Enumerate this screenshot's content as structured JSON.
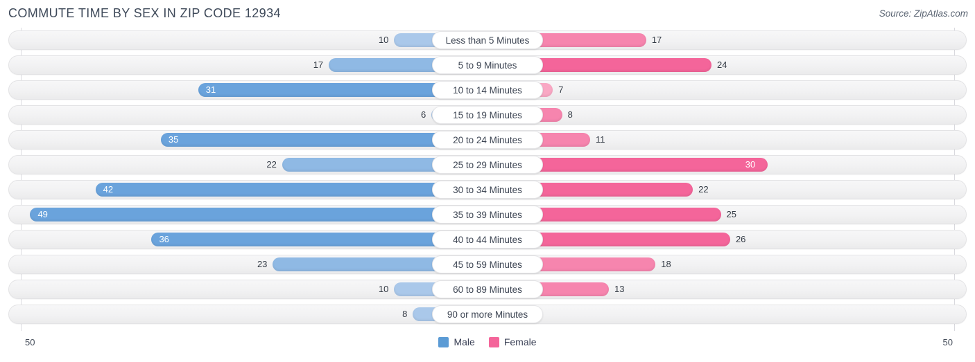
{
  "header": {
    "title": "COMMUTE TIME BY SEX IN ZIP CODE 12934",
    "source": "Source: ZipAtlas.com"
  },
  "axis": {
    "left_max_label": "50",
    "right_max_label": "50"
  },
  "legend": {
    "items": [
      {
        "label": "Male",
        "color": "#5b9bd5"
      },
      {
        "label": "Female",
        "color": "#f4659a"
      }
    ]
  },
  "colors": {
    "male": "#6aa3dc",
    "male_light": "#aac8ea",
    "female": "#f4659a",
    "female_light": "#f9a8c4",
    "track": "#f2f2f3",
    "gridline": "#d9d9de",
    "text": "#3c4257"
  },
  "chart_data": {
    "type": "bar",
    "subtype": "diverging-tornado",
    "title": "COMMUTE TIME BY SEX IN ZIP CODE 12934",
    "subtitle": "",
    "xlabel": "",
    "ylabel": "",
    "xlim": [
      0,
      50
    ],
    "grid": true,
    "legend_position": "bottom-center",
    "axis_max": 50,
    "categories": [
      "Less than 5 Minutes",
      "5 to 9 Minutes",
      "10 to 14 Minutes",
      "15 to 19 Minutes",
      "20 to 24 Minutes",
      "25 to 29 Minutes",
      "30 to 34 Minutes",
      "35 to 39 Minutes",
      "40 to 44 Minutes",
      "45 to 59 Minutes",
      "60 to 89 Minutes",
      "90 or more Minutes"
    ],
    "series": [
      {
        "name": "Male",
        "side": "left",
        "color": "#6aa3dc",
        "values": [
          10,
          17,
          31,
          6,
          35,
          22,
          42,
          49,
          36,
          23,
          10,
          8
        ]
      },
      {
        "name": "Female",
        "side": "right",
        "color": "#f4659a",
        "values": [
          17,
          24,
          7,
          8,
          11,
          30,
          22,
          25,
          26,
          18,
          13,
          0
        ]
      }
    ]
  },
  "rows": [
    {
      "label": "Less than 5 Minutes",
      "male": 10,
      "female": 17,
      "male_label": "10",
      "female_label": "17",
      "male_shade": "light",
      "female_shade": "mid",
      "male_inside": false,
      "female_inside": false
    },
    {
      "label": "5 to 9 Minutes",
      "male": 17,
      "female": 24,
      "male_label": "17",
      "female_label": "24",
      "male_shade": "mid",
      "female_shade": "full",
      "male_inside": false,
      "female_inside": false
    },
    {
      "label": "10 to 14 Minutes",
      "male": 31,
      "female": 7,
      "male_label": "31",
      "female_label": "7",
      "male_shade": "full",
      "female_shade": "light",
      "male_inside": true,
      "female_inside": false
    },
    {
      "label": "15 to 19 Minutes",
      "male": 6,
      "female": 8,
      "male_label": "6",
      "female_label": "8",
      "male_shade": "light",
      "female_shade": "mid",
      "male_inside": false,
      "female_inside": false
    },
    {
      "label": "20 to 24 Minutes",
      "male": 35,
      "female": 11,
      "male_label": "35",
      "female_label": "11",
      "male_shade": "full",
      "female_shade": "mid",
      "male_inside": true,
      "female_inside": false
    },
    {
      "label": "25 to 29 Minutes",
      "male": 22,
      "female": 30,
      "male_label": "22",
      "female_label": "30",
      "male_shade": "mid",
      "female_shade": "full",
      "male_inside": false,
      "female_inside": true
    },
    {
      "label": "30 to 34 Minutes",
      "male": 42,
      "female": 22,
      "male_label": "42",
      "female_label": "22",
      "male_shade": "full",
      "female_shade": "full",
      "male_inside": true,
      "female_inside": false
    },
    {
      "label": "35 to 39 Minutes",
      "male": 49,
      "female": 25,
      "male_label": "49",
      "female_label": "25",
      "male_shade": "full",
      "female_shade": "full",
      "male_inside": true,
      "female_inside": false
    },
    {
      "label": "40 to 44 Minutes",
      "male": 36,
      "female": 26,
      "male_label": "36",
      "female_label": "26",
      "male_shade": "full",
      "female_shade": "full",
      "male_inside": true,
      "female_inside": false
    },
    {
      "label": "45 to 59 Minutes",
      "male": 23,
      "female": 18,
      "male_label": "23",
      "female_label": "18",
      "male_shade": "mid",
      "female_shade": "mid",
      "male_inside": false,
      "female_inside": false
    },
    {
      "label": "60 to 89 Minutes",
      "male": 10,
      "female": 13,
      "male_label": "10",
      "female_label": "13",
      "male_shade": "light",
      "female_shade": "mid",
      "male_inside": false,
      "female_inside": false
    },
    {
      "label": "90 or more Minutes",
      "male": 8,
      "female": 0,
      "male_label": "8",
      "female_label": "0",
      "male_shade": "light",
      "female_shade": "light",
      "male_inside": false,
      "female_inside": false
    }
  ]
}
